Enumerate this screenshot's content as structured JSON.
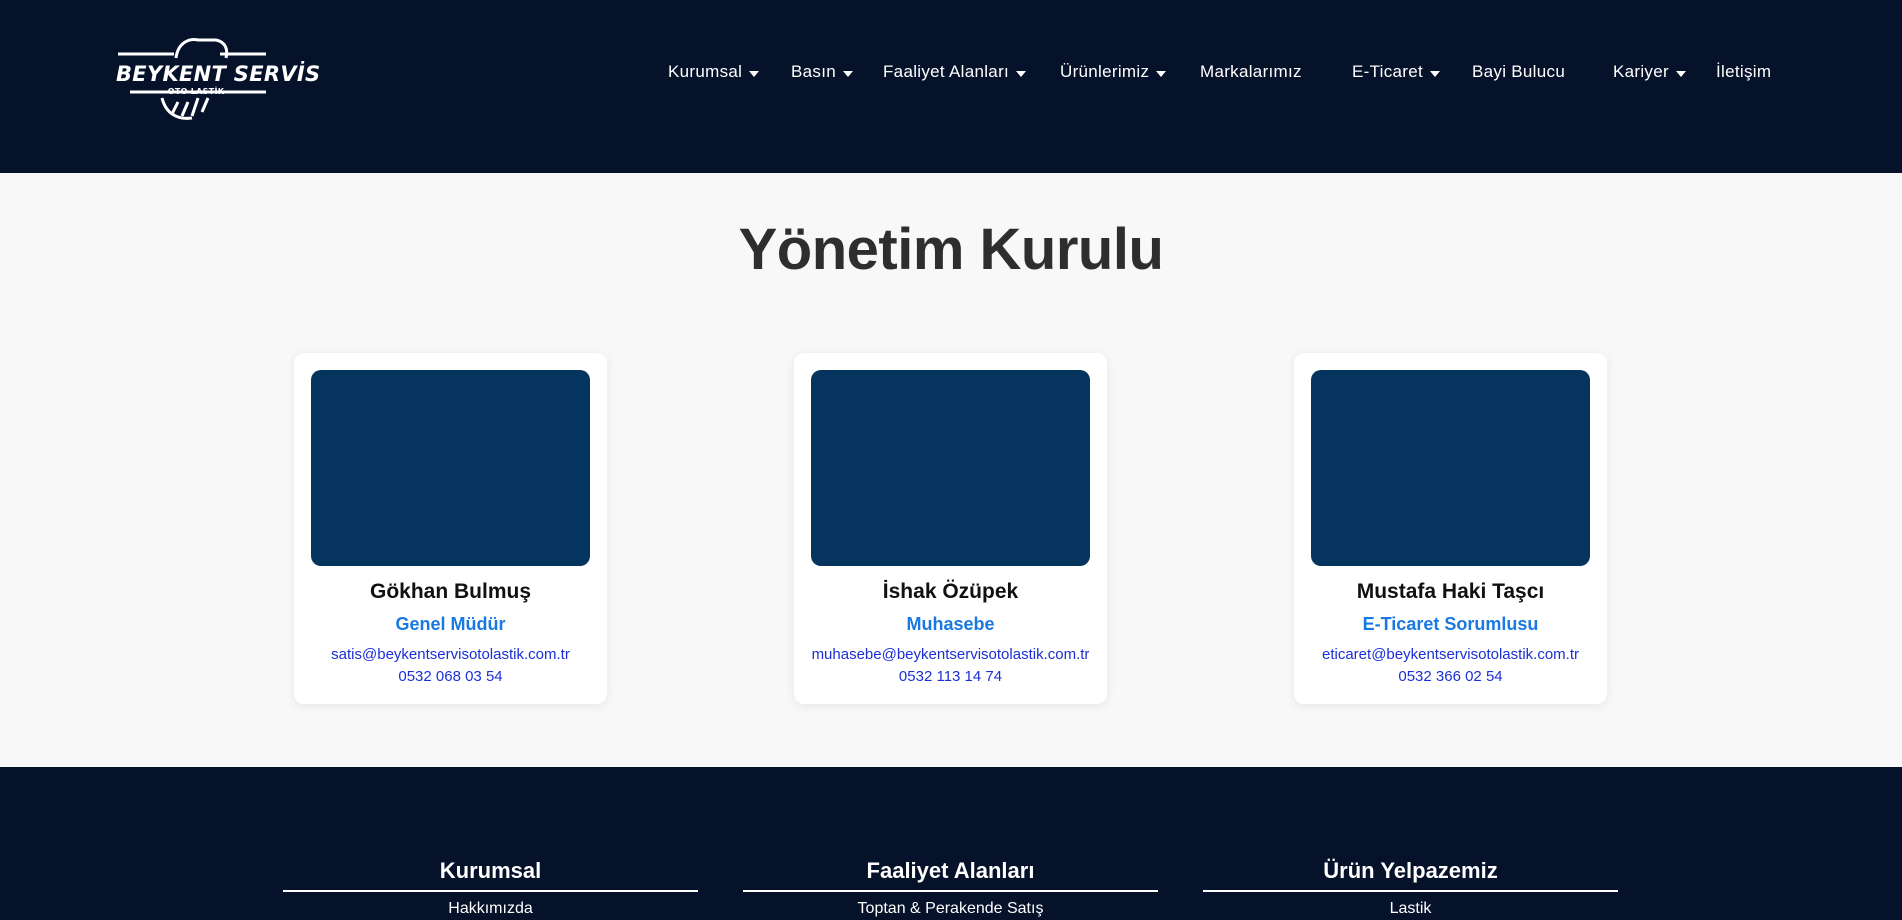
{
  "header": {
    "logo_text": "BEYKENT SERVİS",
    "logo_sub": "OTO LASTİK",
    "nav": [
      {
        "label": "Kurumsal"
      },
      {
        "label": "Basın"
      },
      {
        "label": "Faaliyet Alanları"
      },
      {
        "label": "Ürünlerimiz"
      },
      {
        "label": "Markalarımız"
      },
      {
        "label": "E-Ticaret"
      },
      {
        "label": "Bayi Bulucu"
      },
      {
        "label": "Kariyer"
      },
      {
        "label": "İletişim"
      }
    ]
  },
  "main": {
    "title": "Yönetim Kurulu",
    "members": [
      {
        "name": "Gökhan Bulmuş",
        "role": "Genel Müdür",
        "email": "satis@beykentservisotolastik.com.tr",
        "phone": "0532 068 03 54"
      },
      {
        "name": "İshak Özüpek",
        "role": "Muhasebe",
        "email": "muhasebe@beykentservisotolastik.com.tr",
        "phone": "0532 113 14 74"
      },
      {
        "name": "Mustafa Haki Taşcı",
        "role": "E-Ticaret Sorumlusu",
        "email": "eticaret@beykentservisotolastik.com.tr",
        "phone": "0532 366 02 54"
      }
    ]
  },
  "footer": {
    "columns": [
      {
        "title": "Kurumsal",
        "first_link": "Hakkımızda"
      },
      {
        "title": "Faaliyet Alanları",
        "first_link": "Toptan & Perakende Satış"
      },
      {
        "title": "Ürün Yelpazemiz",
        "first_link": "Lastik"
      }
    ]
  },
  "colors": {
    "header_bg": "#06112a",
    "page_bg": "#f8f8f8",
    "photo_placeholder": "#05345f",
    "role_accent": "#1a79e0",
    "contact_link": "#1b2fd6"
  }
}
